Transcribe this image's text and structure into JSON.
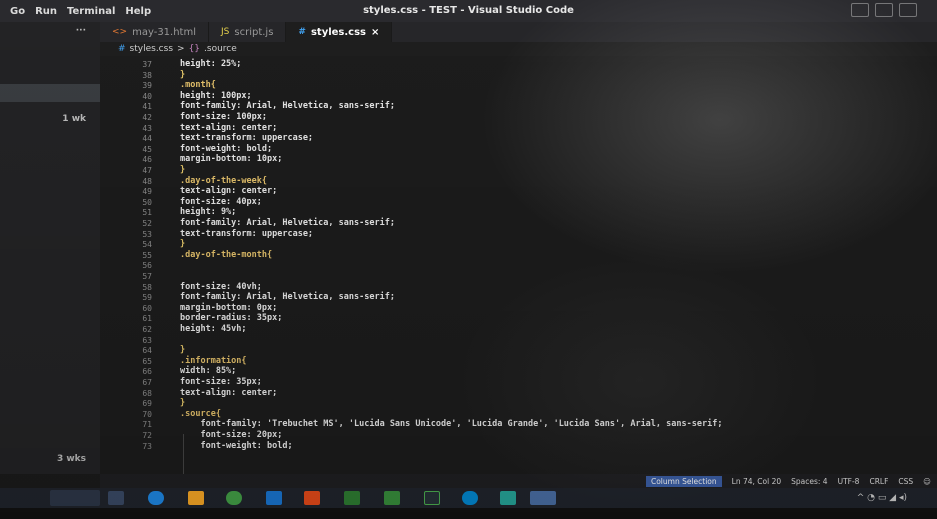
{
  "menu": {
    "items": [
      "Go",
      "Run",
      "Terminal",
      "Help"
    ]
  },
  "window": {
    "title": "styles.css - TEST - Visual Studio Code"
  },
  "sidebar": {
    "more": "···",
    "count_1": "1 wk",
    "count_2": "3 wks"
  },
  "tabs": [
    {
      "icon": "<>",
      "label": "may-31.html"
    },
    {
      "icon": "JS",
      "label": "script.js"
    },
    {
      "icon": "#",
      "label": "styles.css",
      "close": "×"
    }
  ],
  "breadcrumb": {
    "file": "styles.css",
    "sep": ">",
    "symbol_icon": "{}",
    "symbol": ".source"
  },
  "code_lines": [
    {
      "n": "37",
      "text": "height: 25%;"
    },
    {
      "n": "38",
      "text": "}"
    },
    {
      "n": "39",
      "text": ".month{"
    },
    {
      "n": "40",
      "text": "height: 100px;"
    },
    {
      "n": "41",
      "text": "font-family: Arial, Helvetica, sans-serif;"
    },
    {
      "n": "42",
      "text": "font-size: 100px;"
    },
    {
      "n": "43",
      "text": "text-align: center;"
    },
    {
      "n": "44",
      "text": "text-transform: uppercase;"
    },
    {
      "n": "45",
      "text": "font-weight: bold;"
    },
    {
      "n": "46",
      "text": "margin-bottom: 10px;"
    },
    {
      "n": "47",
      "text": "}"
    },
    {
      "n": "48",
      "text": ".day-of-the-week{"
    },
    {
      "n": "49",
      "text": "text-align: center;"
    },
    {
      "n": "50",
      "text": "font-size: 40px;"
    },
    {
      "n": "51",
      "text": "height: 9%;"
    },
    {
      "n": "52",
      "text": "font-family: Arial, Helvetica, sans-serif;"
    },
    {
      "n": "53",
      "text": "text-transform: uppercase;"
    },
    {
      "n": "54",
      "text": "}"
    },
    {
      "n": "55",
      "text": ".day-of-the-month{"
    },
    {
      "n": "56",
      "text": ""
    },
    {
      "n": "57",
      "text": ""
    },
    {
      "n": "58",
      "text": "font-size: 40vh;"
    },
    {
      "n": "59",
      "text": "font-family: Arial, Helvetica, sans-serif;"
    },
    {
      "n": "60",
      "text": "margin-bottom: 0px;"
    },
    {
      "n": "61",
      "text": "border-radius: 35px;"
    },
    {
      "n": "62",
      "text": "height: 45vh;"
    },
    {
      "n": "63",
      "text": ""
    },
    {
      "n": "64",
      "text": "}"
    },
    {
      "n": "65",
      "text": ".information{"
    },
    {
      "n": "66",
      "text": "width: 85%;"
    },
    {
      "n": "67",
      "text": "font-size: 35px;"
    },
    {
      "n": "68",
      "text": "text-align: center;"
    },
    {
      "n": "69",
      "text": "}"
    },
    {
      "n": "70",
      "text": ".source{"
    },
    {
      "n": "71",
      "text": "    font-family: 'Trebuchet MS', 'Lucida Sans Unicode', 'Lucida Grande', 'Lucida Sans', Arial, sans-serif;"
    },
    {
      "n": "72",
      "text": "    font-size: 20px;"
    },
    {
      "n": "73",
      "text": "    font-weight: bold;"
    }
  ],
  "statusbar": {
    "mode": "Column Selection",
    "position": "Ln 74, Col 20",
    "spaces": "Spaces: 4",
    "encoding": "UTF-8",
    "eol": "CRLF",
    "language": "CSS"
  },
  "colors": {
    "accent": "#3b5fa8",
    "selector": "#e4c16b",
    "value": "#d89a6a"
  }
}
